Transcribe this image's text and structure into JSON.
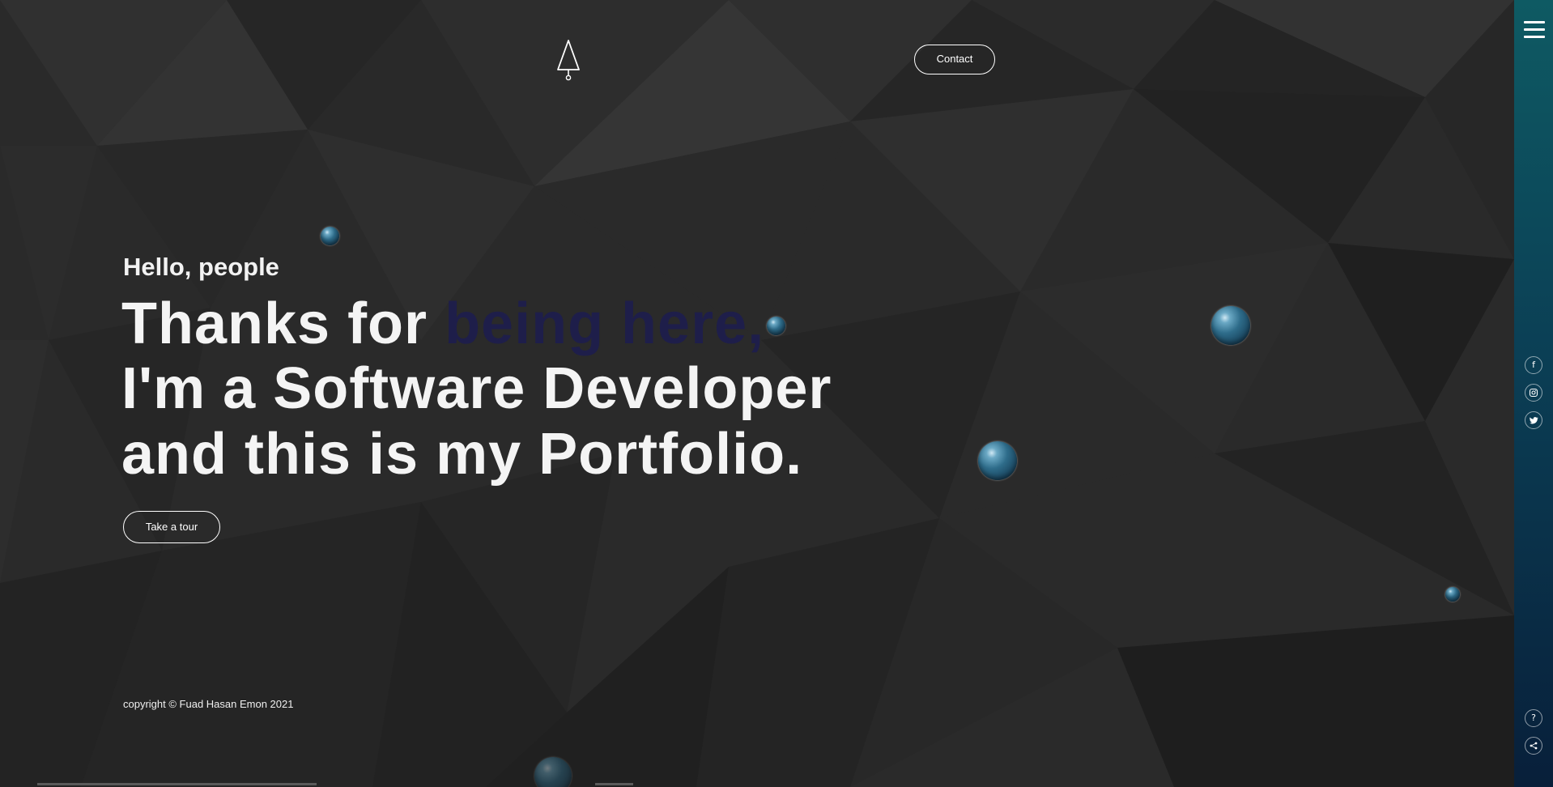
{
  "header": {
    "logo_icon": "rocket-outline-icon",
    "contact_label": "Contact"
  },
  "hero": {
    "greeting": "Hello, people",
    "line1_prefix": "Thanks for ",
    "line1_accent": "being here,",
    "line2": "I'm a Software Developer",
    "line3": "and this is my Portfolio.",
    "tour_label": "Take a tour"
  },
  "footer": {
    "copyright": "copyright © Fuad Hasan Emon 2021"
  },
  "sidebar": {
    "menu_icon": "hamburger-menu-icon",
    "social": [
      {
        "name": "facebook-icon",
        "glyph": "f"
      },
      {
        "name": "instagram-icon",
        "glyph": ""
      },
      {
        "name": "twitter-icon",
        "glyph": ""
      }
    ],
    "help_glyph": "?",
    "share_icon": "share-icon"
  },
  "colors": {
    "background": "#2b2b2b",
    "accent_text": "#1e1e4a",
    "sidebar_top": "#0e5a63",
    "sidebar_bottom": "#081f3a"
  }
}
